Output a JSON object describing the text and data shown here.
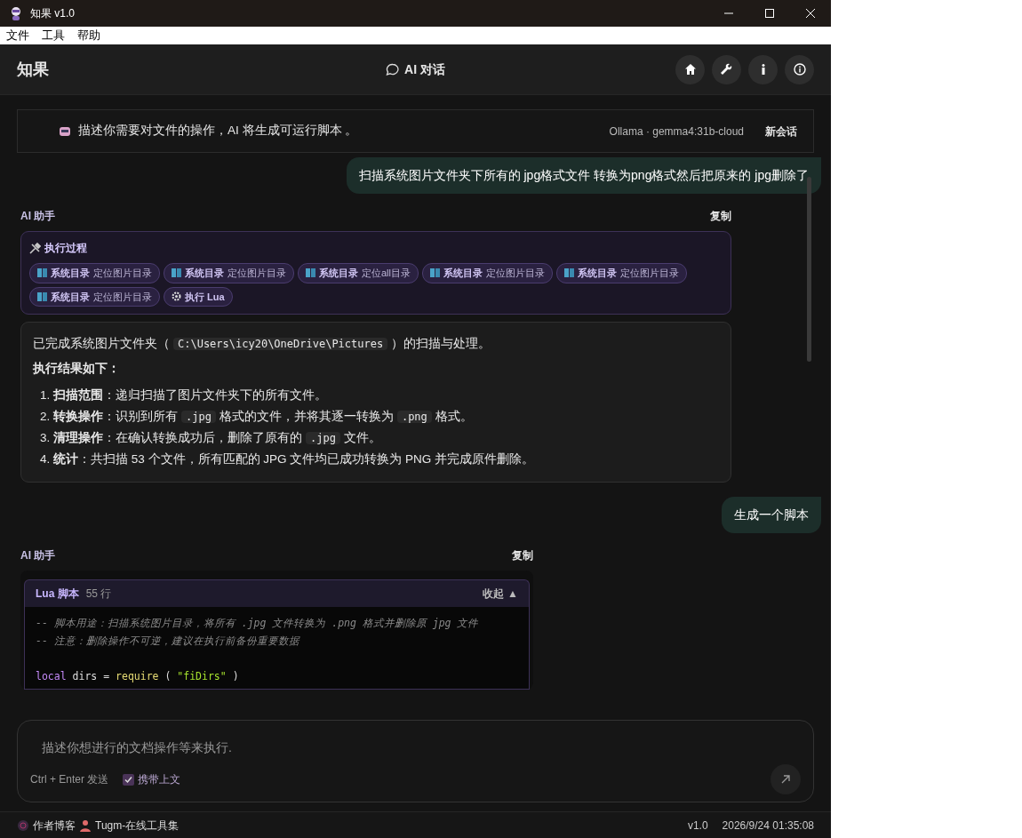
{
  "window": {
    "title": "知果 v1.0"
  },
  "menu": [
    "文件",
    "工具",
    "帮助"
  ],
  "header": {
    "brand": "知果",
    "center": "AI 对话"
  },
  "banner": {
    "text": "描述你需要对文件的操作，AI 将生成可运行脚本 。",
    "model": "Ollama · gemma4:31b-cloud",
    "new_chat": "新会话"
  },
  "messages": [
    {
      "kind": "user",
      "text": "扫描系统图片文件夹下所有的 jpg格式文件 转换为png格式然后把原来的 jpg删除了"
    },
    {
      "kind": "answer",
      "author": "AI 助手",
      "copy": "复制",
      "process": {
        "title": "执行过程",
        "steps": [
          {
            "kind": "dir",
            "label": "系统目录",
            "detail": "定位图片目录"
          },
          {
            "kind": "dir",
            "label": "系统目录",
            "detail": "定位图片目录"
          },
          {
            "kind": "dir",
            "label": "系统目录",
            "detail": "定位all目录"
          },
          {
            "kind": "dir",
            "label": "系统目录",
            "detail": "定位图片目录"
          },
          {
            "kind": "dir",
            "label": "系统目录",
            "detail": "定位图片目录"
          },
          {
            "kind": "dir",
            "label": "系统目录",
            "detail": "定位图片目录"
          },
          {
            "kind": "exec",
            "label": "执行 Lua"
          }
        ]
      },
      "intro": [
        {
          "kind": "text",
          "text": "已完成系统图片文件夹（"
        },
        {
          "kind": "code",
          "text": "C:\\Users\\icy20\\OneDrive\\Pictures"
        },
        {
          "kind": "text",
          "text": "）的扫描与处理。"
        }
      ],
      "heading": "执行结果如下：",
      "items": [
        {
          "marker": "1.",
          "title": "扫描范围",
          "parts": [
            {
              "kind": "text",
              "text": "：递归扫描了图片文件夹下的所有文件。"
            }
          ]
        },
        {
          "marker": "2.",
          "title": "转换操作",
          "parts": [
            {
              "kind": "text",
              "text": "：识别到所有"
            },
            {
              "kind": "code",
              "text": ".jpg"
            },
            {
              "kind": "text",
              "text": "格式的文件，并将其逐一转换为"
            },
            {
              "kind": "code",
              "text": ".png"
            },
            {
              "kind": "text",
              "text": "格式。"
            }
          ]
        },
        {
          "marker": "3.",
          "title": "清理操作",
          "parts": [
            {
              "kind": "text",
              "text": "：在确认转换成功后，删除了原有的"
            },
            {
              "kind": "code",
              "text": ".jpg"
            },
            {
              "kind": "text",
              "text": "文件。"
            }
          ]
        },
        {
          "marker": "4.",
          "title": "统计",
          "parts": [
            {
              "kind": "text",
              "text": "：共扫描 53 个文件，所有匹配的 JPG 文件均已成功转换为 PNG 并完成原件删除。"
            }
          ]
        }
      ]
    },
    {
      "kind": "user",
      "text": "生成一个脚本"
    },
    {
      "kind": "script",
      "author": "AI 助手",
      "copy": "复制",
      "script": {
        "lang": "Lua 脚本",
        "lines": "55 行",
        "collapse": "收起",
        "collapse_icon": "▲",
        "code": [
          {
            "kind": "code",
            "tokens": [
              {
                "kind": "comment",
                "text": "-- 脚本用途：扫描系统图片目录，将所有 .jpg 文件转换为 .png 格式并删除原 jpg 文件"
              }
            ]
          },
          {
            "kind": "code",
            "tokens": [
              {
                "kind": "comment",
                "text": "-- 注意：删除操作不可逆，建议在执行前备份重要数据"
              }
            ]
          },
          {
            "kind": "blank"
          },
          {
            "kind": "code",
            "tokens": [
              {
                "kind": "keyword",
                "text": "local"
              },
              {
                "kind": "plain",
                "text": "dirs ="
              },
              {
                "kind": "function",
                "text": "require"
              },
              {
                "kind": "plain",
                "text": "("
              },
              {
                "kind": "string",
                "text": "\"fiDirs\""
              },
              {
                "kind": "plain",
                "text": ")"
              }
            ]
          }
        ]
      }
    }
  ],
  "composer": {
    "placeholder": "描述你想进行的文档操作等来执行.",
    "hint": "Ctrl + Enter 发送",
    "context": {
      "label": "携带上文",
      "checked": true
    }
  },
  "footer": {
    "links": [
      "作者博客",
      "Tugm-在线工具集"
    ],
    "version": "v1.0",
    "datetime": "2026/9/24 01:35:08"
  }
}
